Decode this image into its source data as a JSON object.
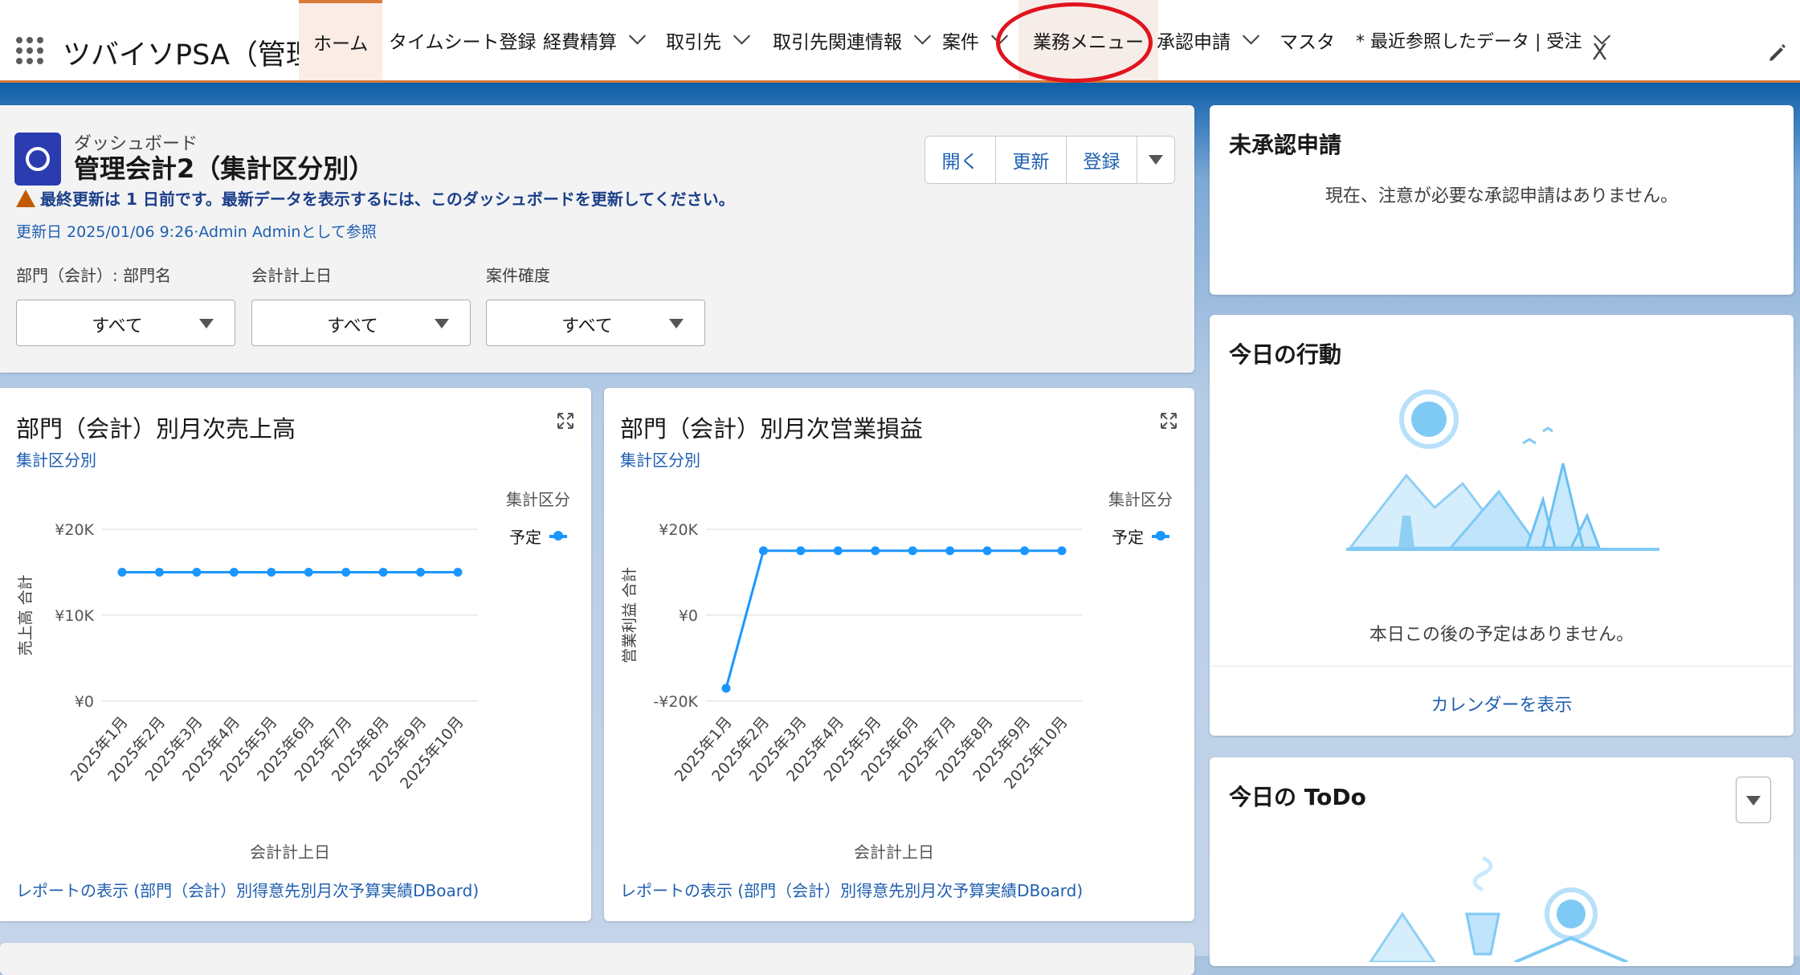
{
  "app": {
    "name": "ツバイソPSA（管理..."
  },
  "nav": {
    "items": [
      {
        "label": "ホーム",
        "chevron": false
      },
      {
        "label": "タイムシート登録",
        "chevron": false
      },
      {
        "label": "経費精算",
        "chevron": true
      },
      {
        "label": "取引先",
        "chevron": true
      },
      {
        "label": "取引先関連情報",
        "chevron": true
      },
      {
        "label": "案件",
        "chevron": true
      },
      {
        "label": "業務メニュー",
        "chevron": false
      },
      {
        "label": "承認申請",
        "chevron": true
      },
      {
        "label": "マスタ",
        "chevron": false
      },
      {
        "label": "* 最近参照したデータ | 受注",
        "chevron": true
      }
    ],
    "close": "X",
    "colors": {
      "accent": "#d87a3a",
      "highlight_circle": "#e0141e"
    }
  },
  "dashboard": {
    "type_label": "ダッシュボード",
    "title": "管理会計2（集計区分別）",
    "warning": "最終更新は 1 日前です。最新データを表示するには、このダッシュボードを更新してください。",
    "updated": "更新日 2025/01/06 9:26·Admin Adminとして参照",
    "buttons": {
      "open": "開く",
      "refresh": "更新",
      "register": "登録"
    },
    "filters": [
      {
        "label": "部門（会計）: 部門名",
        "value": "すべて"
      },
      {
        "label": "会計計上日",
        "value": "すべて"
      },
      {
        "label": "案件確度",
        "value": "すべて"
      }
    ]
  },
  "charts": [
    {
      "title": "部門（会計）別月次売上高",
      "subtitle": "集計区分別",
      "legend_title": "集計区分",
      "legend_item": "予定",
      "report_link": "レポートの表示 (部門（会計）別得意先別月次予算実績DBoard)",
      "yticks": [
        "¥20K",
        "¥10K",
        "¥0"
      ],
      "ylabel": "売上高 合計",
      "xlabel": "会計計上日"
    },
    {
      "title": "部門（会計）別月次営業損益",
      "subtitle": "集計区分別",
      "legend_title": "集計区分",
      "legend_item": "予定",
      "report_link": "レポートの表示 (部門（会計）別得意先別月次予算実績DBoard)",
      "yticks": [
        "¥20K",
        "¥0",
        "-¥20K"
      ],
      "ylabel": "営業利益 合計",
      "xlabel": "会計計上日"
    }
  ],
  "chart_data": [
    {
      "type": "line",
      "categories": [
        "2025年1月",
        "2025年2月",
        "2025年3月",
        "2025年4月",
        "2025年5月",
        "2025年6月",
        "2025年7月",
        "2025年8月",
        "2025年9月",
        "2025年10月"
      ],
      "series": [
        {
          "name": "予定",
          "values": [
            15000,
            15000,
            15000,
            15000,
            15000,
            15000,
            15000,
            15000,
            15000,
            15000
          ]
        }
      ],
      "title": "部門（会計）別月次売上高",
      "xlabel": "会計計上日",
      "ylabel": "売上高 合計",
      "ylim": [
        0,
        20000
      ],
      "yticks": [
        0,
        10000,
        20000
      ],
      "color": "#1b96ff",
      "grid": true,
      "legend": "top-right"
    },
    {
      "type": "line",
      "categories": [
        "2025年1月",
        "2025年2月",
        "2025年3月",
        "2025年4月",
        "2025年5月",
        "2025年6月",
        "2025年7月",
        "2025年8月",
        "2025年9月",
        "2025年10月"
      ],
      "series": [
        {
          "name": "予定",
          "values": [
            -17000,
            15000,
            15000,
            15000,
            15000,
            15000,
            15000,
            15000,
            15000,
            15000
          ]
        }
      ],
      "title": "部門（会計）別月次営業損益",
      "xlabel": "会計計上日",
      "ylabel": "営業利益 合計",
      "ylim": [
        -20000,
        20000
      ],
      "yticks": [
        -20000,
        0,
        20000
      ],
      "color": "#1b96ff",
      "grid": true,
      "legend": "top-right"
    }
  ],
  "right": {
    "approvals": {
      "title": "未承認申請",
      "message": "現在、注意が必要な承認申請はありません。"
    },
    "events": {
      "title": "今日の行動",
      "message": "本日この後の予定はありません。",
      "link": "カレンダーを表示"
    },
    "todo": {
      "title": "今日の ToDo"
    }
  }
}
